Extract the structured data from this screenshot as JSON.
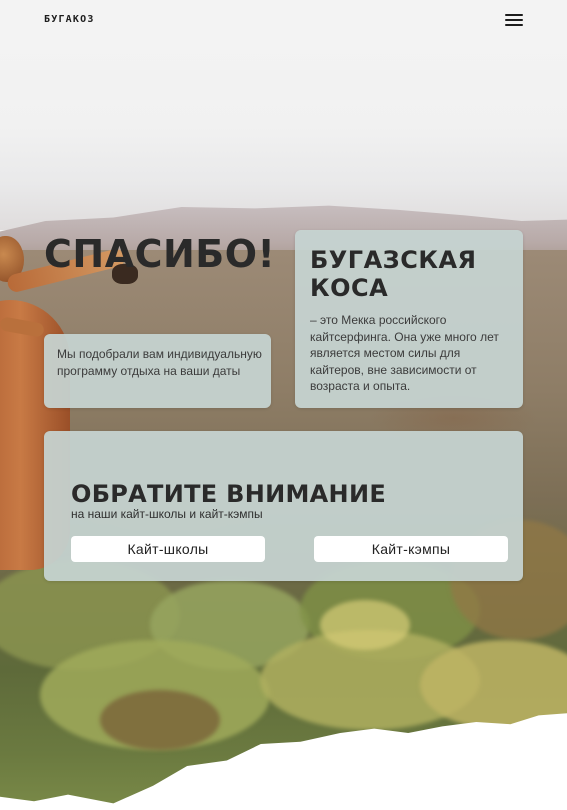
{
  "header": {
    "logo_text": "БУГАКОЗ",
    "menu_icon": "hamburger-menu-icon"
  },
  "hero": {
    "title": "СПАСИБО!",
    "subtitle": "Мы подобрали вам индивидуальную программу отдыха на ваши даты"
  },
  "spit_card": {
    "title": "БУГАЗСКАЯ КОСА",
    "text": "– это Мекка российского кайтсерфинга. Она уже много лет является местом силы для кайтеров, вне зависимости от возраста и опыта."
  },
  "attention": {
    "title": "ОБРАТИТЕ ВНИМАНИЕ",
    "subtitle": "на наши кайт-школы и кайт-кэмпы",
    "buttons": {
      "schools_label": "Кайт-школы",
      "camps_label": "Кайт-кэмпы"
    }
  },
  "colors": {
    "card_bg": "#c6d4d2",
    "text_dark": "#2a2a2a",
    "button_bg": "#ffffff"
  }
}
